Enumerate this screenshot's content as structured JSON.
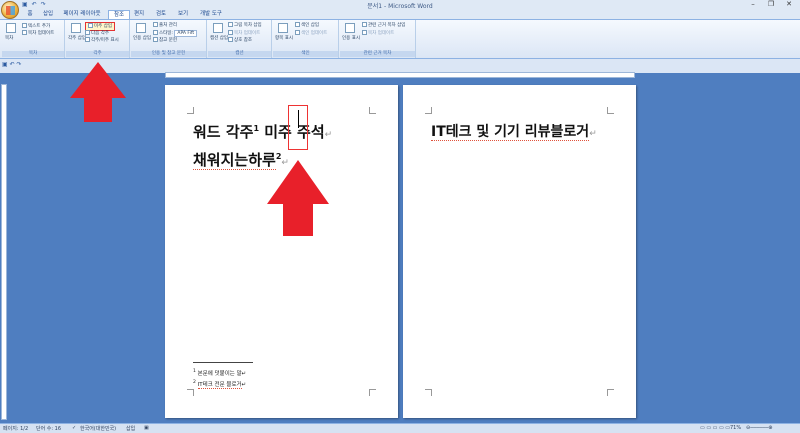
{
  "window": {
    "title": "문서1 - Microsoft Word",
    "quick_access": [
      "저장",
      "실행 취소",
      "다시 실행"
    ],
    "controls": [
      "최소화",
      "최대화",
      "닫기"
    ]
  },
  "tabs": [
    {
      "label": "홈",
      "active": false
    },
    {
      "label": "삽입",
      "active": false
    },
    {
      "label": "페이지 레이아웃",
      "active": false
    },
    {
      "label": "참조",
      "active": true
    },
    {
      "label": "편지",
      "active": false
    },
    {
      "label": "검토",
      "active": false
    },
    {
      "label": "보기",
      "active": false
    },
    {
      "label": "개발 도구",
      "active": false
    }
  ],
  "ribbon": {
    "toc": {
      "label": "목차",
      "big": "목차",
      "add_text": "텍스트 추가",
      "update": "목차 업데이트"
    },
    "footnotes": {
      "label": "각주",
      "insert_endnote": "각주 삽입",
      "insert_footnote": "미주 삽입",
      "next": "다음 각주",
      "show": "각주/미주 표시"
    },
    "citations": {
      "label": "인용 및 참고 문헌",
      "insert": "인용 삽입",
      "manage": "출처 관리",
      "style_label": "스타일:",
      "style_value": "APA Fift",
      "bibliography": "참고 문헌"
    },
    "captions": {
      "label": "캡션",
      "insert": "캡션 삽입",
      "figure_table": "그림 목차 삽입",
      "update_table": "목차 업데이트",
      "cross_ref": "상호 참조"
    },
    "index": {
      "label": "색인",
      "mark": "항목 표시",
      "insert": "색인 삽입",
      "update": "색인 업데이트"
    },
    "authorities": {
      "label": "관련 근거 목차",
      "mark": "인용 표시",
      "insert": "관련 근거 목차 삽입",
      "update": "목차 업데이트"
    }
  },
  "document": {
    "page1": {
      "line1_a": "워드 각주",
      "line1_sup": "1",
      "line1_b": " 미주 주석",
      "line2": "채워지는하루",
      "line2_sup": "2",
      "footnotes": [
        "본문에 덧붙이는 말",
        "IT테크 전문 블로거"
      ]
    },
    "page2": {
      "line1": "IT테크 및 기기 리뷰블로거"
    }
  },
  "statusbar": {
    "page": "페이지: 1/2",
    "words": "단어 수: 16",
    "language": "한국어(대한민국)",
    "mode": "삽입",
    "zoom": "71%"
  },
  "colors": {
    "background": "#4f7ec0",
    "highlight": "#e53333"
  }
}
